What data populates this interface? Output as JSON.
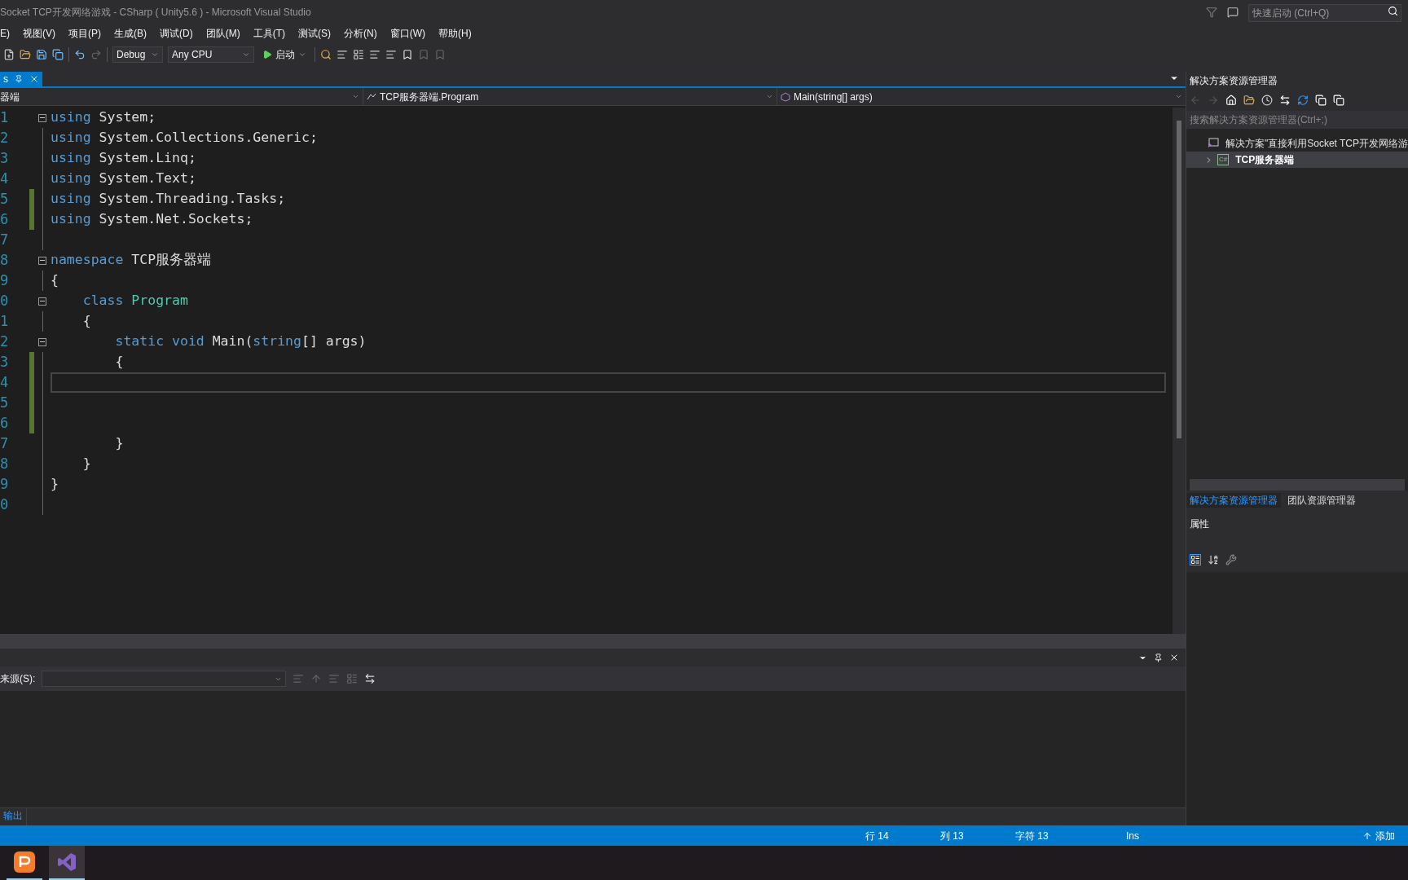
{
  "window": {
    "title": "Socket TCP开发网络游戏 - CSharp ( Unity5.6 ) - Microsoft Visual Studio",
    "quick_launch": {
      "placeholder": "快速启动 (Ctrl+Q)"
    }
  },
  "menu": [
    "E)",
    "视图(V)",
    "项目(P)",
    "生成(B)",
    "调试(D)",
    "团队(M)",
    "工具(T)",
    "测试(S)",
    "分析(N)",
    "窗口(W)",
    "帮助(H)"
  ],
  "toolbar": {
    "configuration": "Debug",
    "platform": "Any CPU",
    "start": "启动"
  },
  "tabs": [
    {
      "label": "s",
      "selected": true
    }
  ],
  "nav_bar": {
    "project": "器端",
    "class": "TCP服务器端.Program",
    "member": "Main(string[] args)"
  },
  "editor": {
    "lines": [
      {
        "number": "1",
        "fold": true,
        "changed": false,
        "current": false,
        "tokens": [
          {
            "t": "using",
            "kind": "keyword"
          },
          {
            "t": " System;",
            "kind": "plain"
          }
        ]
      },
      {
        "number": "2",
        "fold": false,
        "changed": false,
        "current": false,
        "tokens": [
          {
            "t": "using",
            "kind": "keyword"
          },
          {
            "t": " System.Collections.Generic;",
            "kind": "plain"
          }
        ]
      },
      {
        "number": "3",
        "fold": false,
        "changed": false,
        "current": false,
        "tokens": [
          {
            "t": "using",
            "kind": "keyword"
          },
          {
            "t": " System.Linq;",
            "kind": "plain"
          }
        ]
      },
      {
        "number": "4",
        "fold": false,
        "changed": false,
        "current": false,
        "tokens": [
          {
            "t": "using",
            "kind": "keyword"
          },
          {
            "t": " System.Text;",
            "kind": "plain"
          }
        ]
      },
      {
        "number": "5",
        "fold": false,
        "changed": true,
        "current": false,
        "tokens": [
          {
            "t": "using",
            "kind": "keyword"
          },
          {
            "t": " System.Threading.Tasks;",
            "kind": "plain"
          }
        ]
      },
      {
        "number": "6",
        "fold": false,
        "changed": true,
        "current": false,
        "tokens": [
          {
            "t": "using",
            "kind": "keyword"
          },
          {
            "t": " System.Net.Sockets;",
            "kind": "plain"
          }
        ]
      },
      {
        "number": "7",
        "fold": false,
        "changed": false,
        "current": false
      },
      {
        "number": "8",
        "fold": true,
        "changed": false,
        "current": false,
        "tokens": [
          {
            "t": "namespace",
            "kind": "keyword"
          },
          {
            "t": " TCP服务器端",
            "kind": "plain"
          }
        ]
      },
      {
        "number": "9",
        "fold": false,
        "changed": false,
        "current": false,
        "tokens": [
          {
            "t": "{",
            "kind": "plain"
          }
        ]
      },
      {
        "number": "0",
        "fold": true,
        "changed": false,
        "current": false,
        "tokens": [
          {
            "t": "    class",
            "kind": "keyword"
          },
          {
            "t": " Program",
            "kind": "type"
          }
        ]
      },
      {
        "number": "1",
        "fold": false,
        "changed": false,
        "current": false,
        "tokens": [
          {
            "t": "    {",
            "kind": "plain"
          }
        ]
      },
      {
        "number": "2",
        "fold": true,
        "changed": false,
        "current": false,
        "tokens": [
          {
            "t": "        static void",
            "kind": "keyword"
          },
          {
            "t": " Main(",
            "kind": "plain"
          },
          {
            "t": "string",
            "kind": "keyword"
          },
          {
            "t": "[] args)",
            "kind": "plain"
          }
        ]
      },
      {
        "number": "3",
        "fold": false,
        "changed": true,
        "current": false,
        "tokens": [
          {
            "t": "        {",
            "kind": "plain"
          }
        ]
      },
      {
        "number": "4",
        "fold": false,
        "changed": true,
        "current": true
      },
      {
        "number": "5",
        "fold": false,
        "changed": true,
        "current": false
      },
      {
        "number": "6",
        "fold": false,
        "changed": true,
        "current": false
      },
      {
        "number": "7",
        "fold": false,
        "changed": false,
        "current": false,
        "tokens": [
          {
            "t": "        }",
            "kind": "plain"
          }
        ]
      },
      {
        "number": "8",
        "fold": false,
        "changed": false,
        "current": false,
        "tokens": [
          {
            "t": "    }",
            "kind": "plain"
          }
        ]
      },
      {
        "number": "9",
        "fold": false,
        "changed": false,
        "current": false,
        "tokens": [
          {
            "t": "}",
            "kind": "plain"
          }
        ]
      },
      {
        "number": "0",
        "fold": false,
        "changed": false,
        "current": false
      }
    ]
  },
  "solution_explorer": {
    "title": "解决方案资源管理器",
    "search": {
      "placeholder": "搜索解决方案资源管理器(Ctrl+;)"
    },
    "tree": [
      {
        "label": "解决方案\"直接利用Socket TCP开发网络游",
        "kind": "solution",
        "selected": false,
        "children": [
          {
            "label": "TCP服务器端",
            "kind": "project",
            "badge": "C#",
            "selected": true,
            "expanded": false
          }
        ]
      }
    ],
    "tabs": [
      {
        "label": "解决方案资源管理器",
        "selected": true
      },
      {
        "label": "团队资源管理器",
        "selected": false
      }
    ]
  },
  "properties": {
    "title": "属性"
  },
  "output": {
    "source_label": "来源(S):",
    "tabs": [
      {
        "label": "输出",
        "selected": true
      }
    ]
  },
  "status_bar": {
    "line": "行 14",
    "column": "列 13",
    "char": "字符 13",
    "mode": "Ins",
    "source_control": "添加"
  },
  "taskbar": [
    {
      "kind": "presentation",
      "selected": false
    },
    {
      "kind": "visual-studio",
      "selected": true
    }
  ]
}
